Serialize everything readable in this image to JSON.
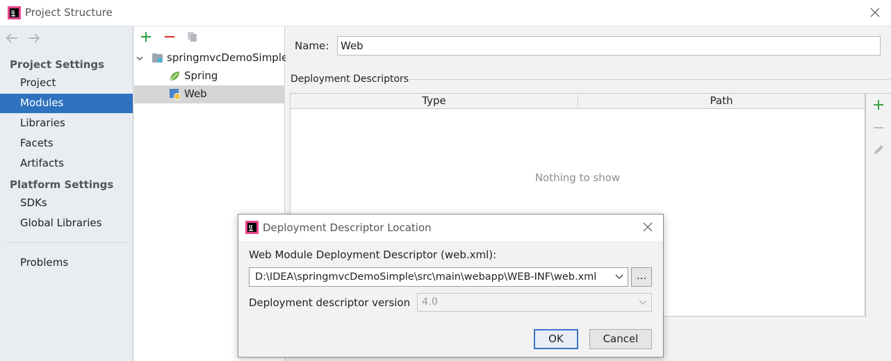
{
  "window": {
    "title": "Project Structure"
  },
  "sidebar": {
    "groups": [
      {
        "label": "Project Settings"
      },
      {
        "label": "Platform Settings"
      }
    ],
    "items": [
      {
        "label": "Project"
      },
      {
        "label": "Modules"
      },
      {
        "label": "Libraries"
      },
      {
        "label": "Facets"
      },
      {
        "label": "Artifacts"
      },
      {
        "label": "SDKs"
      },
      {
        "label": "Global Libraries"
      },
      {
        "label": "Problems"
      }
    ],
    "selected": "Modules"
  },
  "tree": {
    "root": "springmvcDemoSimple",
    "children": [
      {
        "label": "Spring"
      },
      {
        "label": "Web"
      }
    ],
    "selected": "Web"
  },
  "details": {
    "name_label": "Name:",
    "name_value": "Web",
    "section_title": "Deployment Descriptors",
    "columns": [
      "Type",
      "Path"
    ],
    "empty_text": "Nothing to show"
  },
  "dialog": {
    "title": "Deployment Descriptor Location",
    "descriptor_label": "Web Module Deployment Descriptor (web.xml):",
    "descriptor_path": "D:\\IDEA\\springmvcDemoSimple\\src\\main\\webapp\\WEB-INF\\web.xml",
    "browse_label": "...",
    "version_label": "Deployment descriptor version",
    "version_value": "4.0",
    "ok_label": "OK",
    "cancel_label": "Cancel"
  },
  "colors": {
    "selection": "#2f72c0",
    "add": "#3aa34a",
    "remove": "#d9383a"
  }
}
